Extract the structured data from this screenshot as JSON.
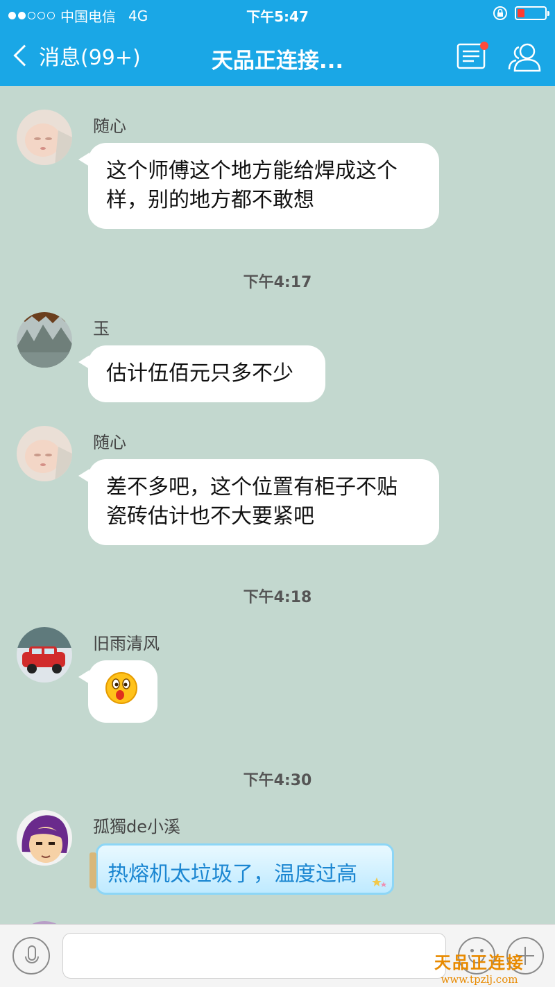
{
  "status_bar": {
    "carrier": "中国电信",
    "network": "4G",
    "time": "下午5:47"
  },
  "nav": {
    "back_label": "消息(99+)",
    "title": "天品正连接..."
  },
  "messages": [
    {
      "sender": "随心",
      "text_lines": [
        "这个师傅这个地方能给焊成这个",
        "样，别的地方都不敢想"
      ]
    },
    {
      "timestamp": "下午4:17"
    },
    {
      "sender": "玉",
      "text_lines": [
        "估计伍佰元只多不少"
      ]
    },
    {
      "sender": "随心",
      "text_lines": [
        "差不多吧，这个位置有柜子不贴",
        "瓷砖估计也不大要紧吧"
      ]
    },
    {
      "timestamp": "下午4:18"
    },
    {
      "sender": "旧雨清风",
      "emoji": "surprised-face-emoji"
    },
    {
      "timestamp": "下午4:30"
    },
    {
      "sender": "孤獨de小溪",
      "text": "热熔机太垃圾了，温度过高"
    }
  ],
  "watermark": {
    "title": "天品正连接",
    "url": "www.tpzlj.com"
  },
  "colors": {
    "nav_bg": "#1aa7e6",
    "chat_bg": "#c3d8cf",
    "bubble_bg": "#ffffff",
    "special_bubble_text": "#1b86d1",
    "watermark": "#e88a00"
  }
}
